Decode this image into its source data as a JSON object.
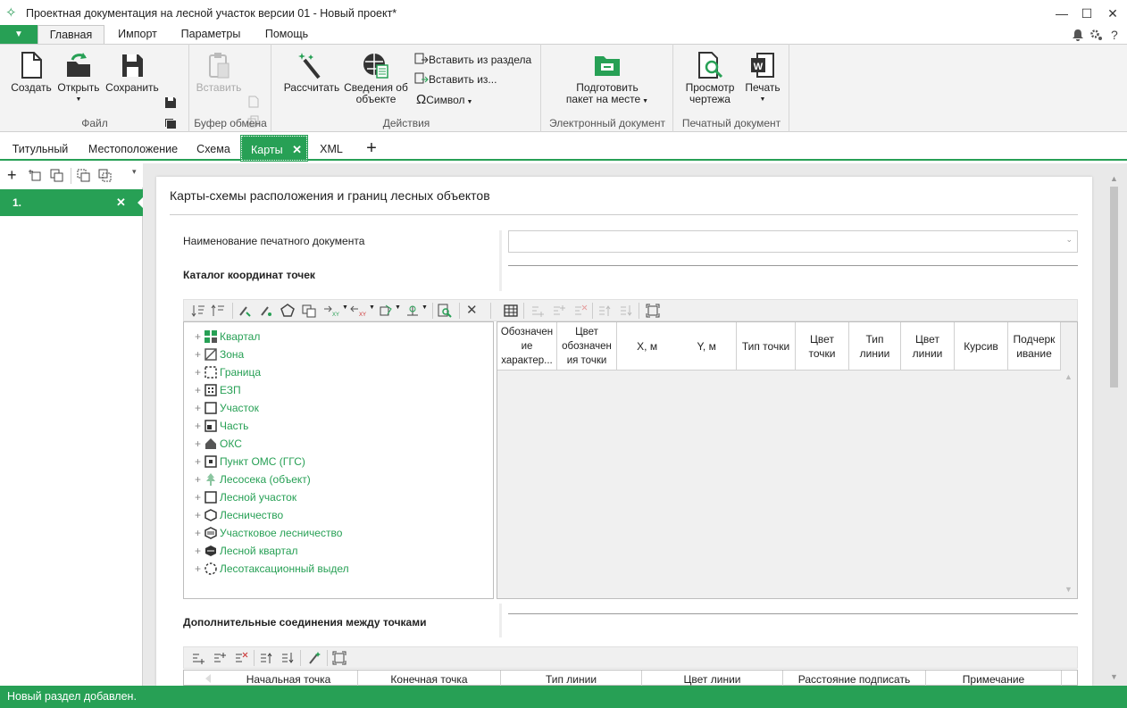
{
  "window": {
    "title": "Проектная документация на лесной участок версии 01 - Новый проект*",
    "minimize": "—",
    "maximize": "☐",
    "close": "✕"
  },
  "menu": {
    "file": "▼",
    "tabs": [
      "Главная",
      "Импорт",
      "Параметры",
      "Помощь"
    ],
    "help": "?"
  },
  "ribbon": {
    "file_group": {
      "label": "Файл",
      "create": "Создать",
      "open": "Открыть",
      "save": "Сохранить"
    },
    "clipboard_group": {
      "label": "Буфер обмена",
      "paste": "Вставить"
    },
    "actions_group": {
      "label": "Действия",
      "calculate": "Рассчитать",
      "info_line1": "Сведения об",
      "info_line2": "объекте",
      "insert_section": "Вставить из раздела",
      "insert_from": "Вставить из...",
      "symbol": "Символ"
    },
    "edoc_group": {
      "label": "Электронный документ",
      "prepare_line1": "Подготовить",
      "prepare_line2": "пакет на месте"
    },
    "print_group": {
      "label": "Печатный документ",
      "preview_line1": "Просмотр",
      "preview_line2": "чертежа",
      "print": "Печать"
    }
  },
  "doc_tabs": [
    "Титульный",
    "Местоположение",
    "Схема",
    "Карты",
    "XML"
  ],
  "section_item": "1.",
  "card": {
    "heading": "Карты-схемы расположения и границ лесных объектов",
    "doc_name_label": "Наименование печатного документа",
    "catalog_label": "Каталог координат точек",
    "extra_label": "Дополнительные соединения между точками"
  },
  "tree_items": [
    {
      "label": "Квартал",
      "icon": "quarter-icon"
    },
    {
      "label": "Зона",
      "icon": "zone-icon"
    },
    {
      "label": "Граница",
      "icon": "border-icon"
    },
    {
      "label": "ЕЗП",
      "icon": "ezp-icon"
    },
    {
      "label": "Участок",
      "icon": "plot-icon"
    },
    {
      "label": "Часть",
      "icon": "part-icon"
    },
    {
      "label": "ОКС",
      "icon": "house-icon"
    },
    {
      "label": "Пункт ОМС (ГГС)",
      "icon": "point-icon"
    },
    {
      "label": "Лесосека (объект)",
      "icon": "tree-icon"
    },
    {
      "label": "Лесной участок",
      "icon": "forest-plot-icon"
    },
    {
      "label": "Лесничество",
      "icon": "hexagon-icon"
    },
    {
      "label": "Участковое лесничество",
      "icon": "hexagon-lines-icon"
    },
    {
      "label": "Лесной квартал",
      "icon": "hexagon-grid-icon"
    },
    {
      "label": "Лесотаксационный выдел",
      "icon": "dashed-circle-icon"
    }
  ],
  "grid_columns": [
    "Обозначен ие характер...",
    "Цвет обозначен ия точки",
    "X, м",
    "Y, м",
    "Тип точки",
    "Цвет точки",
    "Тип линии",
    "Цвет линии",
    "Курсив",
    "Подчерк ивание"
  ],
  "bottom_columns": [
    "Начальная точка",
    "Конечная точка",
    "Тип линии",
    "Цвет линии",
    "Расстояние подписать",
    "Примечание"
  ],
  "status": "Новый раздел добавлен.",
  "colors": {
    "accent": "#27a055"
  }
}
